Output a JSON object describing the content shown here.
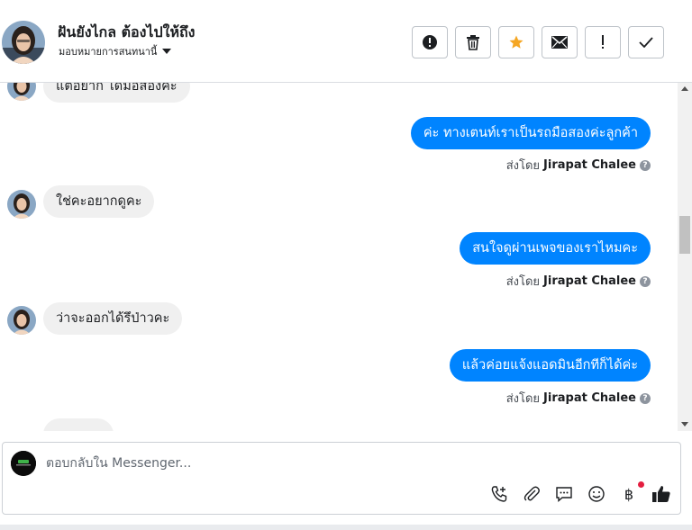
{
  "header": {
    "contact_name": "ฝันยังไกล ต้องไปให้ถึง",
    "assign_label": "มอบหมายการสนทนานี้",
    "actions": [
      {
        "name": "mark-spam-button",
        "icon": "alert-circle-icon"
      },
      {
        "name": "delete-button",
        "icon": "trash-icon"
      },
      {
        "name": "star-button",
        "icon": "star-icon"
      },
      {
        "name": "mark-unread-button",
        "icon": "envelope-icon"
      },
      {
        "name": "follow-up-button",
        "icon": "exclamation-icon"
      },
      {
        "name": "mark-done-button",
        "icon": "check-icon"
      }
    ],
    "accent_star": "#f5a623"
  },
  "messages": [
    {
      "direction": "in",
      "text": "แต่อยาก ได้มือสองคะ"
    },
    {
      "direction": "out",
      "text": "ค่ะ ทางเตนท์เราเป็นรถมือสองค่ะลูกค้า"
    },
    {
      "direction": "in",
      "text": "ใช่คะอยากดูคะ"
    },
    {
      "direction": "out",
      "text": "สนใจดูผ่านเพจของเราไหมคะ"
    },
    {
      "direction": "in",
      "text": "ว่าจะออกได้รึป่าวคะ"
    },
    {
      "direction": "out",
      "text": "แล้วค่อยแจ้งแอดมินอีกทีก็ได้ค่ะ"
    }
  ],
  "sent_by": {
    "prefix": "ส่งโดย",
    "name": "Jirapat Chalee"
  },
  "composer": {
    "placeholder": "ตอบกลับใน Messenger...",
    "tools": [
      "phone-plus-icon",
      "paperclip-icon",
      "chat-bubble-icon",
      "smiley-icon",
      "baht-icon",
      "thumbs-up-icon"
    ],
    "baht_symbol": "฿"
  },
  "colors": {
    "outgoing_bubble": "#0084ff",
    "incoming_bubble": "#f0f0f0",
    "notification_dot": "#e41e3f"
  }
}
